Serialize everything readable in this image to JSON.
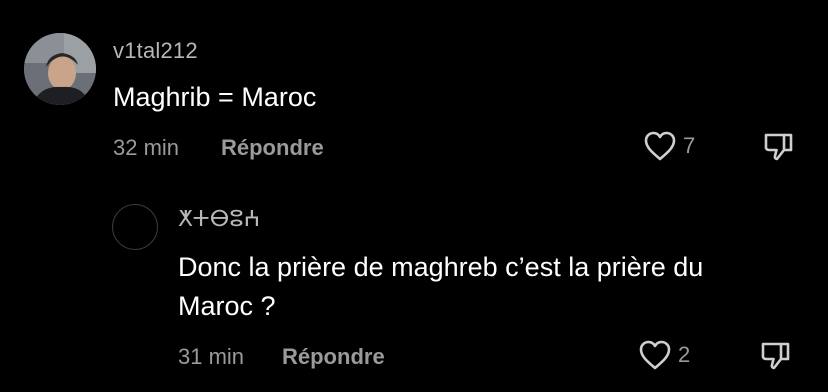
{
  "comments": [
    {
      "username": "v1tal212",
      "text": "Maghrib = Maroc",
      "time": "32 min",
      "reply_label": "Répondre",
      "likes": "7"
    },
    {
      "username": "ⵅⵜⴱⵓⵄ",
      "text_line1": "Donc la prière de maghreb c’est la prière du",
      "text_line2": "Maroc ?",
      "time": "31 min",
      "reply_label": "Répondre",
      "likes": "2"
    }
  ],
  "icons": {
    "like": "heart-icon",
    "dislike": "thumbs-down-icon"
  }
}
